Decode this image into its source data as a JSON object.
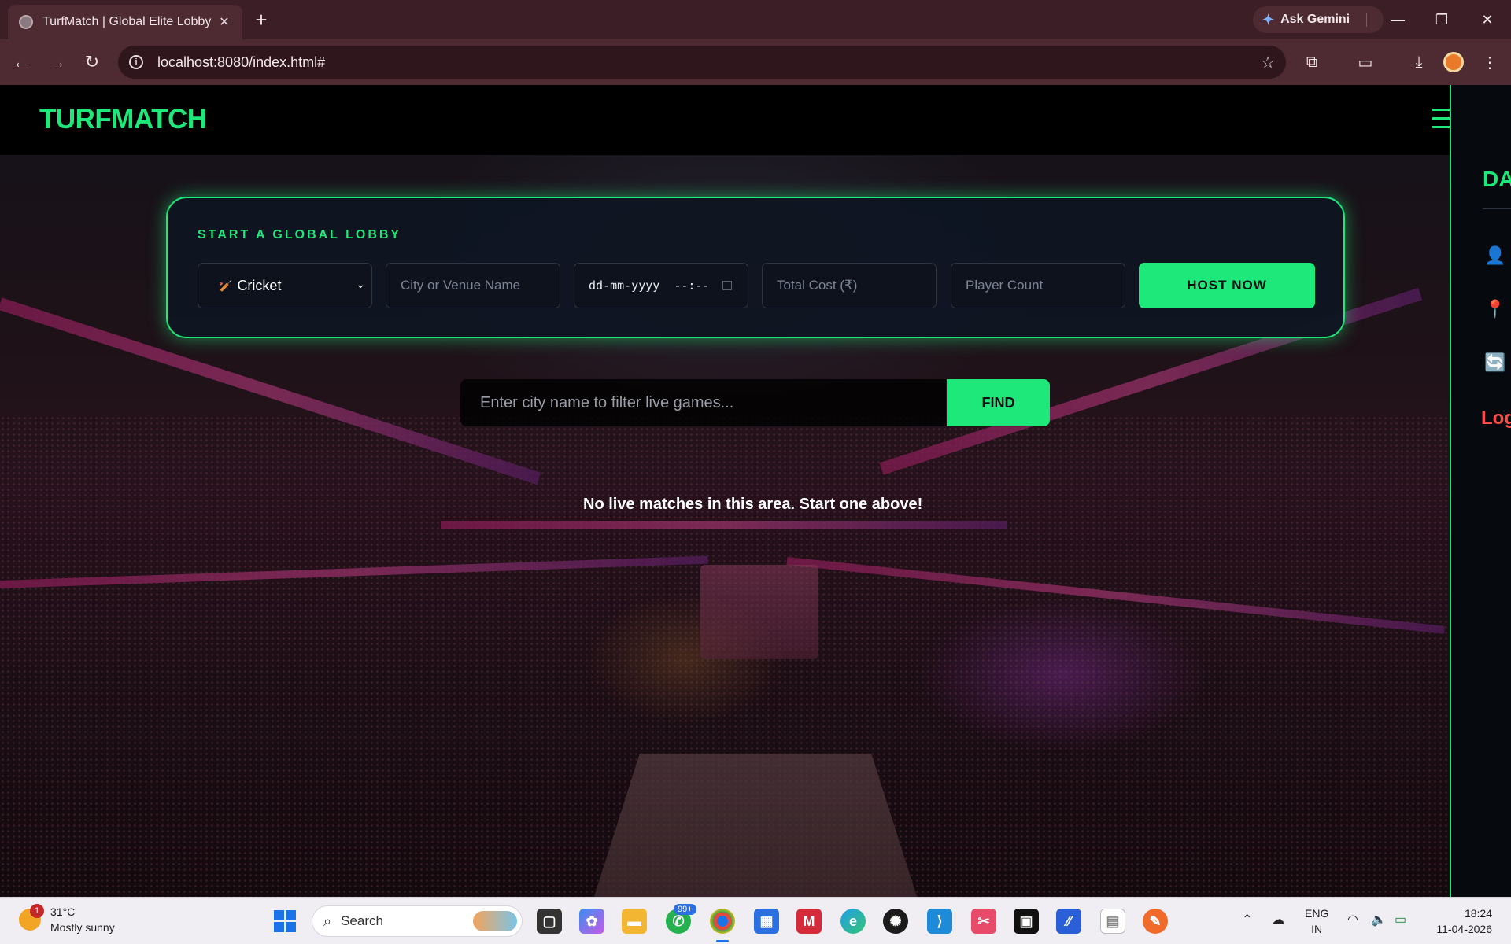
{
  "browser": {
    "tab_title": "TurfMatch | Global Elite Lobby",
    "url": "localhost:8080/index.html#",
    "ask_gemini": "Ask Gemini"
  },
  "app": {
    "logo": "TURFMATCH",
    "accent_color": "#1ee879",
    "lobby": {
      "title": "START A GLOBAL LOBBY",
      "sport_selected": "Cricket",
      "city_placeholder": "City or Venue Name",
      "datetime_placeholder": "dd-mm-yyyy  --:--",
      "cost_placeholder": "Total Cost (₹)",
      "players_placeholder": "Player Count",
      "host_button": "HOST NOW"
    },
    "filter": {
      "placeholder": "Enter city name to filter live games...",
      "find_button": "FIND"
    },
    "empty_message": "No live matches in this area. Start one above!",
    "side_panel": {
      "heading_partial": "DA",
      "logout_partial": "Log"
    }
  },
  "taskbar": {
    "weather_temp": "31°C",
    "weather_desc": "Mostly sunny",
    "weather_badge": "1",
    "search_label": "Search",
    "whatsapp_badge": "99+",
    "lang_top": "ENG",
    "lang_bottom": "IN",
    "time": "18:24",
    "date": "11-04-2026"
  }
}
